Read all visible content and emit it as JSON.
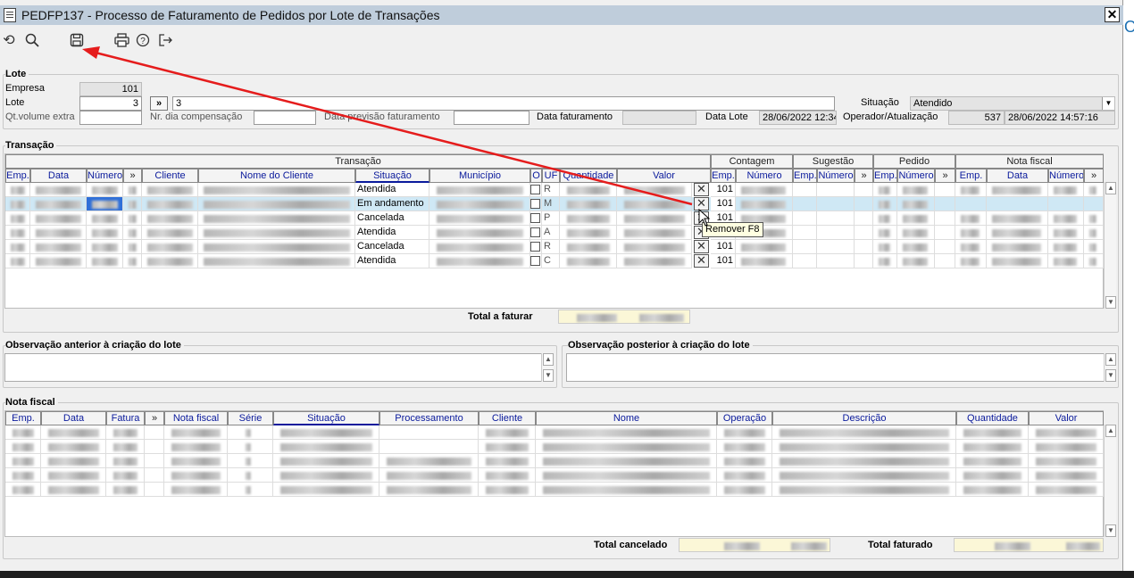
{
  "window": {
    "title": "PEDFP137 - Processo de Faturamento de Pedidos por Lote de Transações",
    "close_label": "✕"
  },
  "toolbar": {
    "icons": [
      "undo-icon",
      "search-icon",
      "save-icon",
      "print-icon",
      "help-icon",
      "exit-icon"
    ]
  },
  "lote": {
    "group_label": "Lote",
    "empresa_label": "Empresa",
    "empresa_value": "101",
    "lote_label": "Lote",
    "lote_value": "3",
    "lote_desc": "3",
    "expand_label": "»",
    "situacao_label": "Situação",
    "situacao_value": "Atendido",
    "qtvolume_label": "Qt.volume extra",
    "nrdia_label": "Nr. dia compensação",
    "dataprev_label": "Data previsão faturamento",
    "datafat_label": "Data faturamento",
    "datalote_label": "Data Lote",
    "datalote_value": "28/06/2022 12:34",
    "operador_label": "Operador/Atualização",
    "operador_value": "537",
    "atualizacao_value": "28/06/2022 14:57:16"
  },
  "transacao": {
    "group_label": "Transação",
    "super_headers": {
      "transacao": "Transação",
      "contagem": "Contagem",
      "sugestao": "Sugestão",
      "pedido": "Pedido",
      "nota": "Nota fiscal"
    },
    "columns": {
      "emp": "Emp.",
      "data": "Data",
      "numero": "Número",
      "exp": "»",
      "cliente": "Cliente",
      "nome": "Nome do Cliente",
      "situacao": "Situação",
      "municipio": "Município",
      "o": "O",
      "uf": "UF",
      "quantidade": "Quantidade",
      "valor": "Valor",
      "c_emp": "Emp.",
      "c_num": "Número",
      "s_emp": "Emp.",
      "s_num": "Número",
      "p_emp": "Emp.",
      "p_num": "Número",
      "n_emp": "Emp.",
      "n_data": "Data",
      "n_num": "Número"
    },
    "rows": [
      {
        "situacao": "Atendida",
        "cont_emp": "101",
        "uf": "R"
      },
      {
        "situacao": "Em andamento",
        "cont_emp": "101",
        "uf": "M"
      },
      {
        "situacao": "Cancelada",
        "cont_emp": "101",
        "uf": "P"
      },
      {
        "situacao": "Atendida",
        "cont_emp": "101",
        "uf": "A"
      },
      {
        "situacao": "Cancelada",
        "cont_emp": "101",
        "uf": "R"
      },
      {
        "situacao": "Atendida",
        "cont_emp": "101",
        "uf": "C"
      }
    ],
    "remove_icon": "✕",
    "tooltip": "Remover F8",
    "total_label": "Total a faturar"
  },
  "obs": {
    "anterior_label": "Observação anterior à criação do lote",
    "posterior_label": "Observação posterior à criação do lote"
  },
  "nota": {
    "group_label": "Nota fiscal",
    "columns": {
      "emp": "Emp.",
      "data": "Data",
      "fatura": "Fatura",
      "exp": "»",
      "nota": "Nota fiscal",
      "serie": "Série",
      "situacao": "Situação",
      "processamento": "Processamento",
      "cliente": "Cliente",
      "nome": "Nome",
      "operacao": "Operação",
      "descricao": "Descrição",
      "quantidade": "Quantidade",
      "valor": "Valor"
    },
    "total_cancelado_label": "Total cancelado",
    "total_faturado_label": "Total faturado"
  },
  "colors": {
    "header_text": "#0a1a9c",
    "selected_row": "#cfe8f5",
    "total_field": "#fbf7d7",
    "annotation_arrow": "#e51c1c"
  }
}
